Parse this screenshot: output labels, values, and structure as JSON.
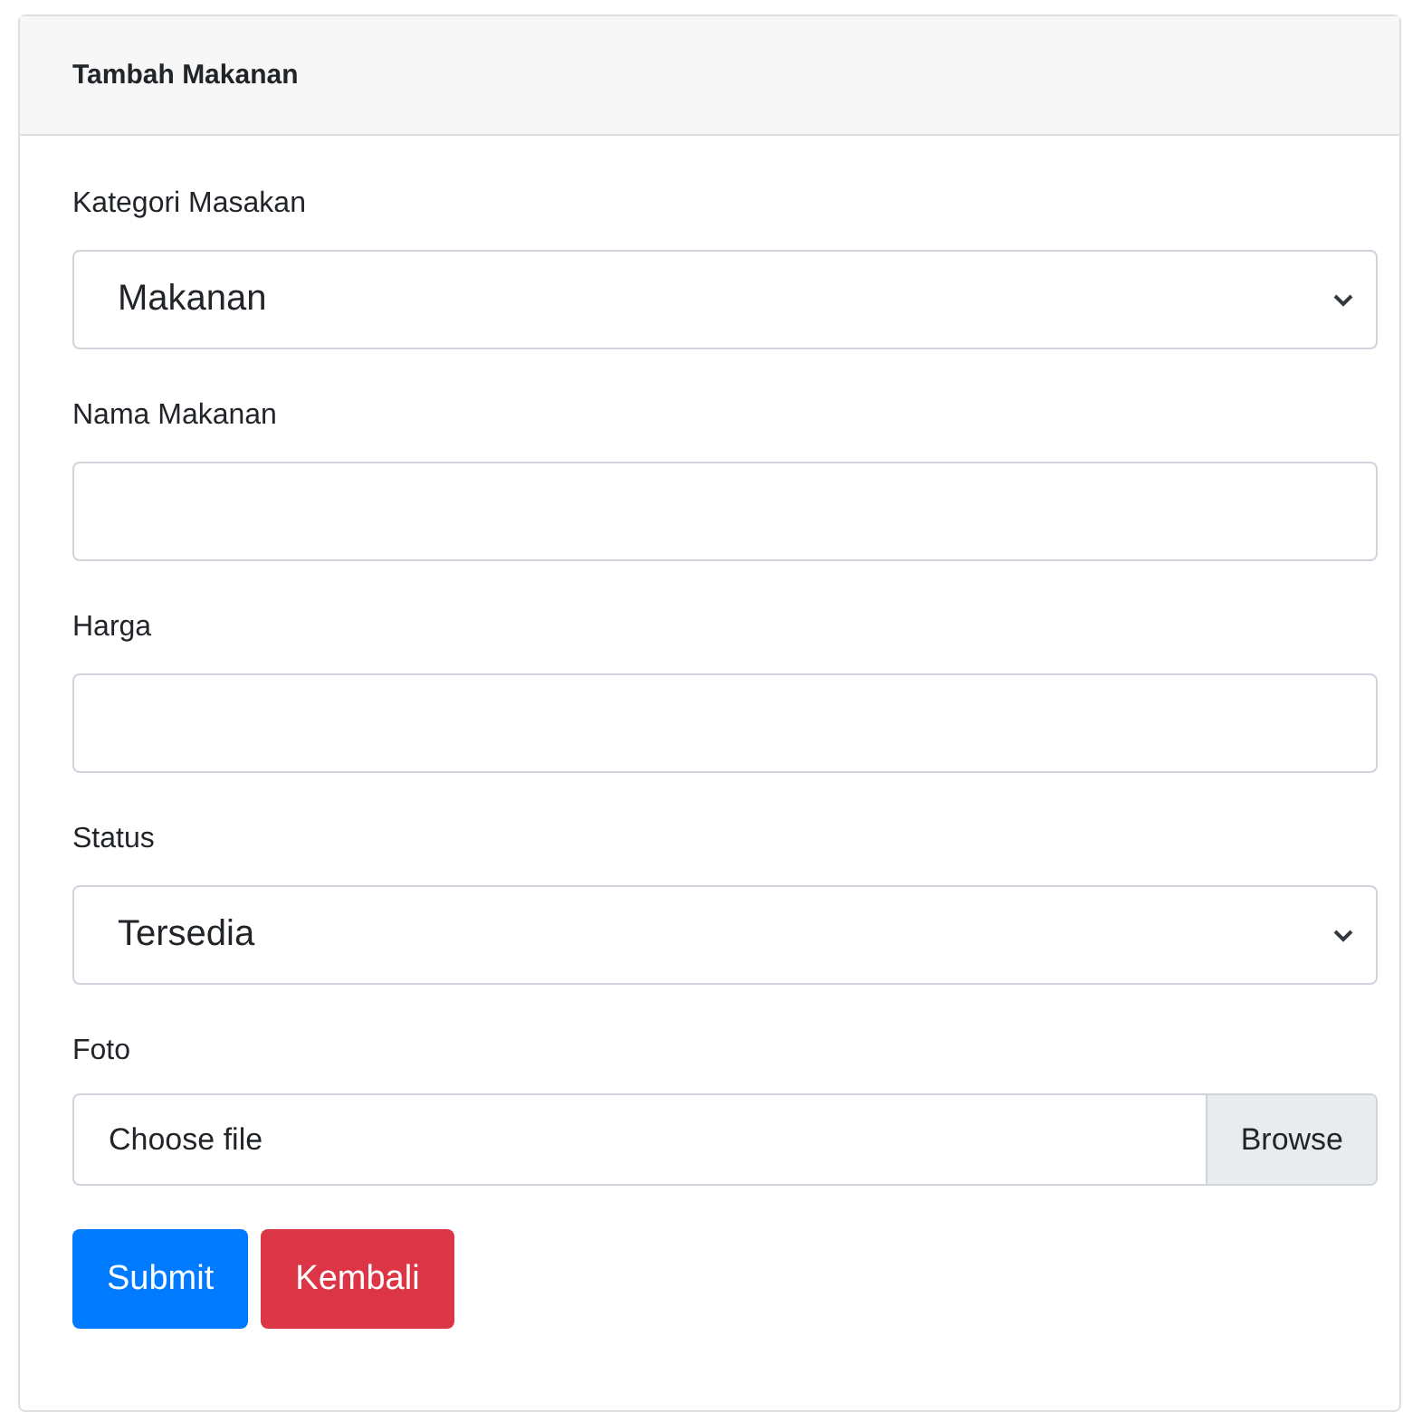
{
  "card": {
    "title": "Tambah Makanan"
  },
  "fields": [
    {
      "kind": "select",
      "label": "Kategori Masakan",
      "value": "Makanan"
    },
    {
      "kind": "text",
      "label": "Nama Makanan"
    },
    {
      "kind": "text",
      "label": "Harga"
    },
    {
      "kind": "select",
      "label": "Status",
      "value": "Tersedia"
    },
    {
      "kind": "file",
      "label": "Foto",
      "value": "Choose file",
      "button": "Browse"
    }
  ],
  "buttons": [
    {
      "kind": "primary",
      "label": "Submit"
    },
    {
      "kind": "danger",
      "label": "Kembali"
    }
  ]
}
